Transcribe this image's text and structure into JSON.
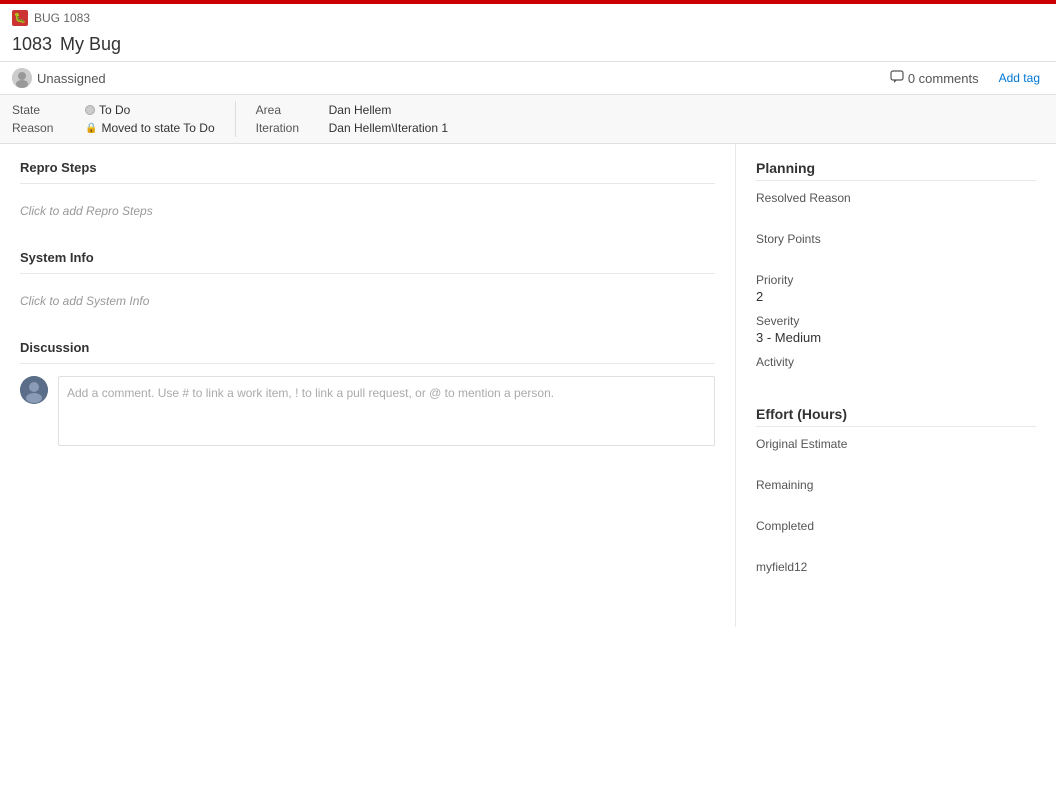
{
  "topBar": {
    "bugIcon": "🐛",
    "bugIdLabel": "BUG 1083"
  },
  "workItem": {
    "id": "1083",
    "title": "My Bug"
  },
  "metadata": {
    "assignee": "Unassigned",
    "commentsCount": "0 comments",
    "addTagLabel": "Add tag"
  },
  "fields": {
    "stateLabel": "State",
    "stateValue": "To Do",
    "reasonLabel": "Reason",
    "reasonValue": "Moved to state To Do",
    "areaLabel": "Area",
    "areaValue": "Dan Hellem",
    "iterationLabel": "Iteration",
    "iterationValue": "Dan Hellem\\Iteration 1"
  },
  "leftPanel": {
    "reproStepsTitle": "Repro Steps",
    "reproStepsPlaceholder": "Click to add Repro Steps",
    "systemInfoTitle": "System Info",
    "systemInfoPlaceholder": "Click to add System Info",
    "discussionTitle": "Discussion",
    "commentPlaceholder": "Add a comment. Use # to link a work item, ! to link a pull request, or @ to mention a person."
  },
  "rightPanel": {
    "planningTitle": "Planning",
    "resolvedReasonLabel": "Resolved Reason",
    "resolvedReasonValue": "",
    "storyPointsLabel": "Story Points",
    "storyPointsValue": "",
    "priorityLabel": "Priority",
    "priorityValue": "2",
    "severityLabel": "Severity",
    "severityValue": "3 - Medium",
    "activityLabel": "Activity",
    "activityValue": "",
    "effortTitle": "Effort (Hours)",
    "originalEstimateLabel": "Original Estimate",
    "originalEstimateValue": "",
    "remainingLabel": "Remaining",
    "remainingValue": "",
    "completedLabel": "Completed",
    "completedValue": "",
    "myfield12Label": "myfield12",
    "myfield12Value": ""
  }
}
